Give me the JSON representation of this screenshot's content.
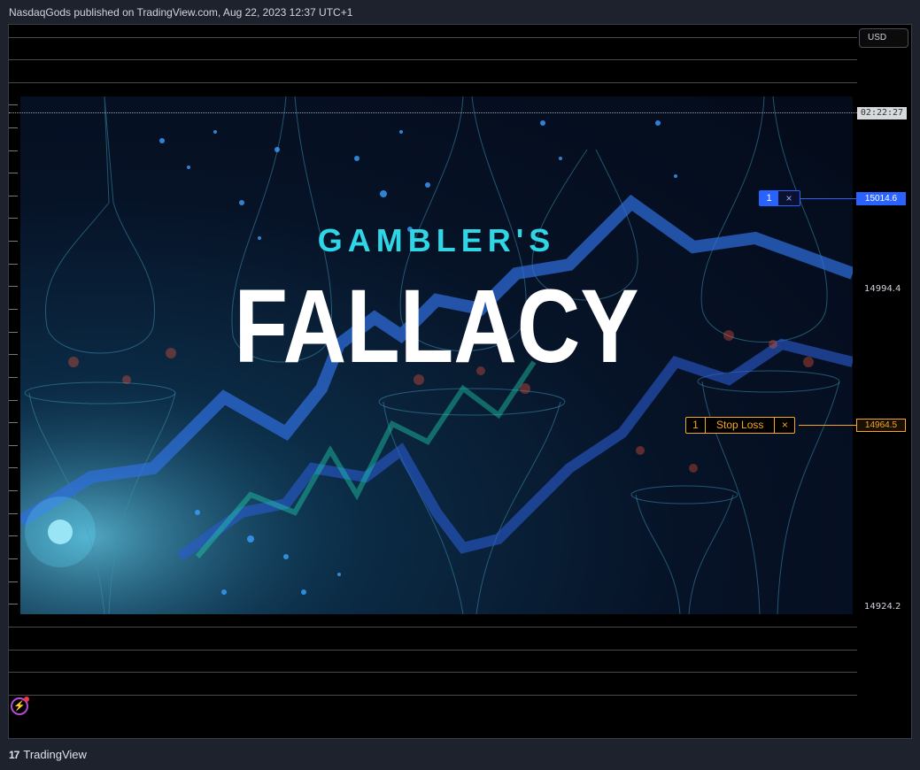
{
  "header": {
    "publish_text": "NasdaqGods published on TradingView.com, Aug 22, 2023 12:37 UTC+1"
  },
  "chart": {
    "currency_button": "USD",
    "crosshair_time": "02:22:27",
    "price_labels": [
      "14994.4",
      "14924.2"
    ],
    "image_title_top": "GAMBLER'S",
    "image_title_main": "FALLACY",
    "colors": {
      "blue_order": "#2962ff",
      "stop_loss": "#f5a623",
      "title_cyan": "#2fd6e6"
    }
  },
  "orders": {
    "entry": {
      "qty": "1",
      "close_icon": "×",
      "price": "15014.6"
    },
    "stop_loss": {
      "qty": "1",
      "label": "Stop Loss",
      "close_icon": "×",
      "price": "14964.5"
    }
  },
  "footer": {
    "logo_mark": "17",
    "brand": "TradingView"
  }
}
